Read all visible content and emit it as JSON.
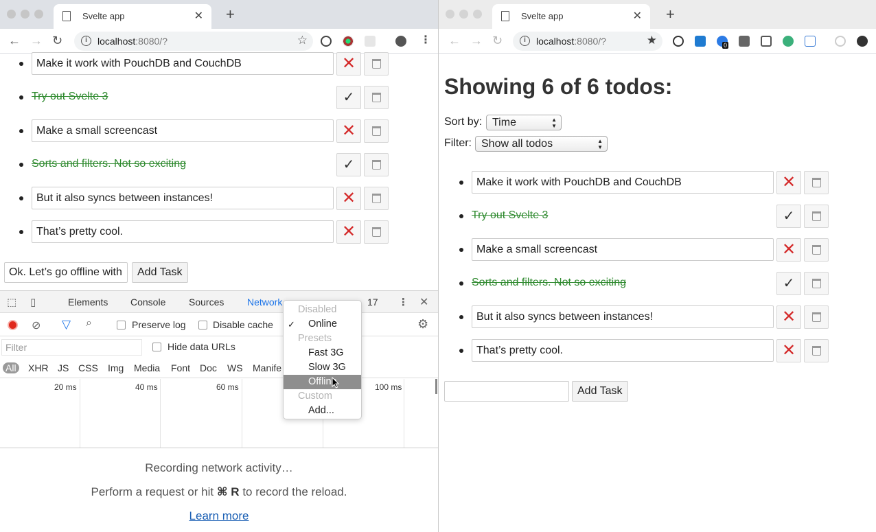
{
  "left_window": {
    "tab_title": "Svelte app",
    "url_host": "localhost",
    "url_path": ":8080/?",
    "todos": [
      {
        "text": "Make it work with PouchDB and CouchDB",
        "done": false
      },
      {
        "text": "Try out Svelte 3",
        "done": true
      },
      {
        "text": "Make a small screencast",
        "done": false
      },
      {
        "text": "Sorts and filters. Not so exciting",
        "done": true
      },
      {
        "text": "But it also syncs between instances!",
        "done": false
      },
      {
        "text": "That’s pretty cool.",
        "done": false
      }
    ],
    "new_task_value": "Ok. Let’s go offline with",
    "add_task_label": "Add Task"
  },
  "devtools": {
    "tabs": [
      "Elements",
      "Console",
      "Sources",
      "Network"
    ],
    "more_tabs": "»",
    "error_count": "17",
    "preserve_log": "Preserve log",
    "disable_cache": "Disable cache",
    "filter_placeholder": "Filter",
    "hide_data_urls": "Hide data URLs",
    "filter_types": [
      "All",
      "XHR",
      "JS",
      "CSS",
      "Img",
      "Media",
      "Font",
      "Doc",
      "WS",
      "Manife"
    ],
    "ticks": [
      "20 ms",
      "40 ms",
      "60 ms",
      "100 ms"
    ],
    "recording_text": "Recording network activity…",
    "hint_prefix": "Perform a request or hit",
    "hint_key": "⌘ R",
    "hint_suffix": "to record the reload.",
    "learn_more": "Learn more",
    "throttle_menu": {
      "disabled_header": "Disabled",
      "online": "Online",
      "presets_header": "Presets",
      "fast3g": "Fast 3G",
      "slow3g": "Slow 3G",
      "offline": "Offline",
      "custom_header": "Custom",
      "add": "Add..."
    }
  },
  "right_window": {
    "tab_title": "Svelte app",
    "url_host": "localhost",
    "url_path": ":8080/?",
    "extension_badge": "0",
    "heading": "Showing 6 of 6 todos:",
    "sort_label": "Sort by:",
    "sort_value": "Time",
    "filter_label": "Filter:",
    "filter_value": "Show all todos",
    "todos": [
      {
        "text": "Make it work with PouchDB and CouchDB",
        "done": false
      },
      {
        "text": "Try out Svelte 3",
        "done": true
      },
      {
        "text": "Make a small screencast",
        "done": false
      },
      {
        "text": "Sorts and filters. Not so exciting",
        "done": true
      },
      {
        "text": "But it also syncs between instances!",
        "done": false
      },
      {
        "text": "That’s pretty cool.",
        "done": false
      }
    ],
    "new_task_value": "",
    "add_task_label": "Add Task"
  },
  "colors": {
    "done_green": "#2f8a2f",
    "delete_red": "#d42a2a",
    "devtools_active": "#1a73e8",
    "record_red": "#e0281c"
  }
}
